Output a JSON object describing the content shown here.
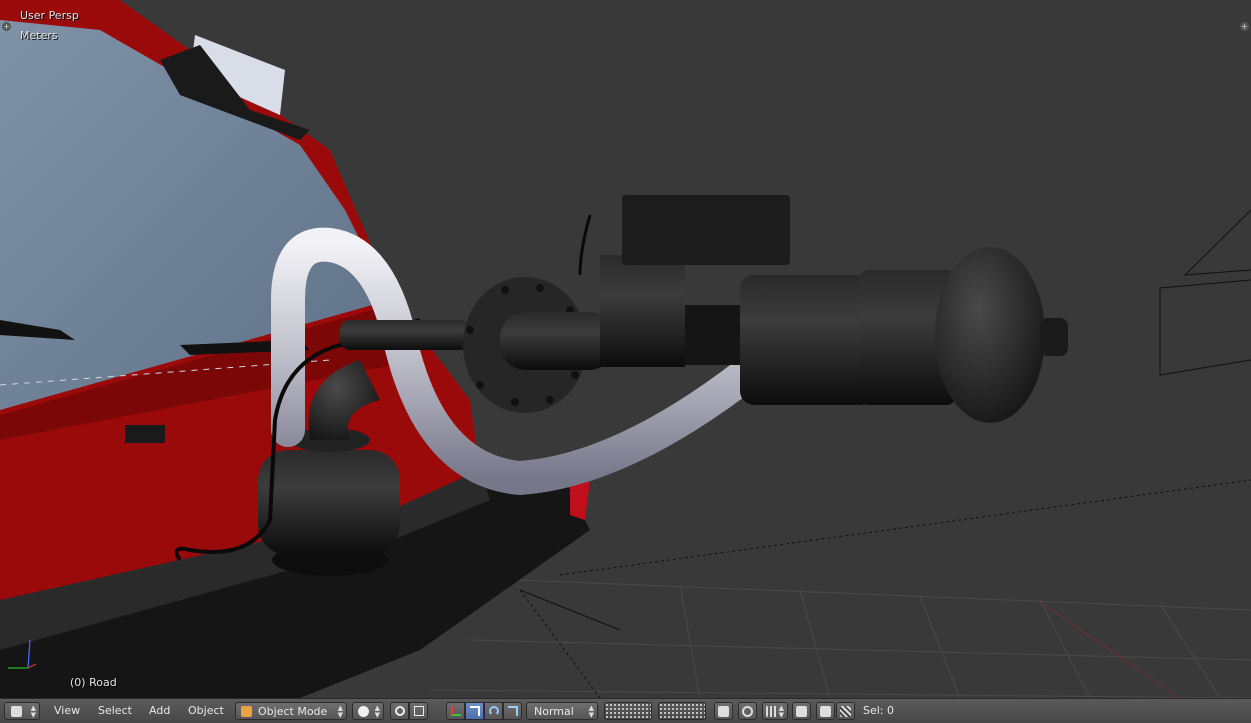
{
  "viewport": {
    "view_name": "User Persp",
    "units": "Meters",
    "active_object": "(0) Road"
  },
  "header": {
    "editor_icon": "3d-view-icon",
    "menus": [
      "View",
      "Select",
      "Add",
      "Object"
    ],
    "mode": "Object Mode",
    "transform_orientation": "Normal",
    "selection_status": "Sel: 0"
  },
  "colors": {
    "viewport_bg": "#393939",
    "header_bg": "#4f4f4f",
    "active_blue": "#5680c2",
    "car_red": "#9b0a0a",
    "pipe_silver": "#c8c8d2"
  }
}
